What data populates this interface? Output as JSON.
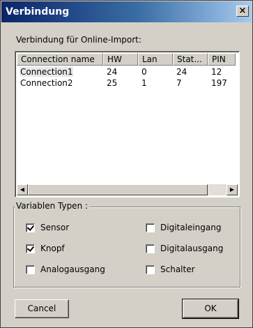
{
  "window": {
    "title": "Verbindung",
    "close_glyph": "×"
  },
  "list_label": "Verbindung für Online-Import:",
  "listview": {
    "columns": [
      "Connection name",
      "HW",
      "Lan",
      "Stat...",
      "PIN"
    ],
    "rows": [
      [
        "Connection1",
        "24",
        "0",
        "24",
        "12"
      ],
      [
        "Connection2",
        "25",
        "1",
        "7",
        "197"
      ]
    ],
    "scroll_left_glyph": "◀",
    "scroll_right_glyph": "▶"
  },
  "group": {
    "title": "Variablen Typen :",
    "checkboxes": [
      {
        "label": "Sensor",
        "checked": true
      },
      {
        "label": "Digitaleingang",
        "checked": false
      },
      {
        "label": "Knopf",
        "checked": true
      },
      {
        "label": "Digitalausgang",
        "checked": false
      },
      {
        "label": "Analogausgang",
        "checked": false
      },
      {
        "label": "Schalter",
        "checked": false
      }
    ]
  },
  "buttons": {
    "cancel": "Cancel",
    "ok": "OK"
  }
}
